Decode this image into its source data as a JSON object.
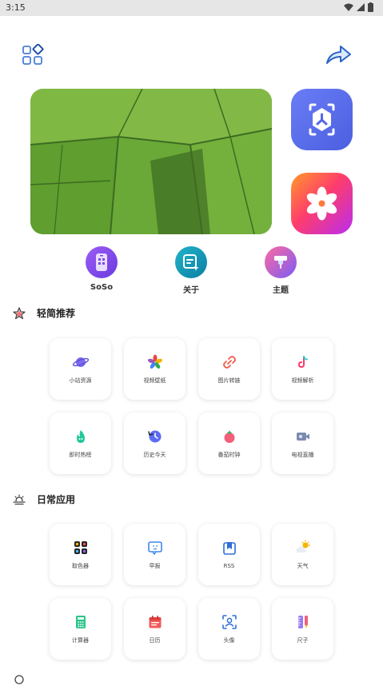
{
  "status": {
    "time": "3:15"
  },
  "quick": [
    {
      "label": "SoSo"
    },
    {
      "label": "关于"
    },
    {
      "label": "主题"
    }
  ],
  "sections": [
    {
      "title": "轻简推荐",
      "items": [
        {
          "label": "小站资源",
          "icon": "planet-icon"
        },
        {
          "label": "视频壁纸",
          "icon": "flower-icon"
        },
        {
          "label": "图片转链",
          "icon": "link-icon"
        },
        {
          "label": "视频解析",
          "icon": "tiktok-icon"
        },
        {
          "label": "即时热榜",
          "icon": "flame-icon"
        },
        {
          "label": "历史今天",
          "icon": "history-clock-icon"
        },
        {
          "label": "番茄时钟",
          "icon": "tomato-icon"
        },
        {
          "label": "电视直播",
          "icon": "tv-camera-icon"
        }
      ]
    },
    {
      "title": "日常应用",
      "items": [
        {
          "label": "取色器",
          "icon": "color-picker-icon"
        },
        {
          "label": "早报",
          "icon": "chat-bubble-icon"
        },
        {
          "label": "RSS",
          "icon": "bookmark-icon"
        },
        {
          "label": "天气",
          "icon": "weather-icon"
        },
        {
          "label": "计算器",
          "icon": "calculator-icon"
        },
        {
          "label": "日历",
          "icon": "calendar-icon"
        },
        {
          "label": "头像",
          "icon": "avatar-icon"
        },
        {
          "label": "尺子",
          "icon": "ruler-icon"
        }
      ]
    }
  ]
}
